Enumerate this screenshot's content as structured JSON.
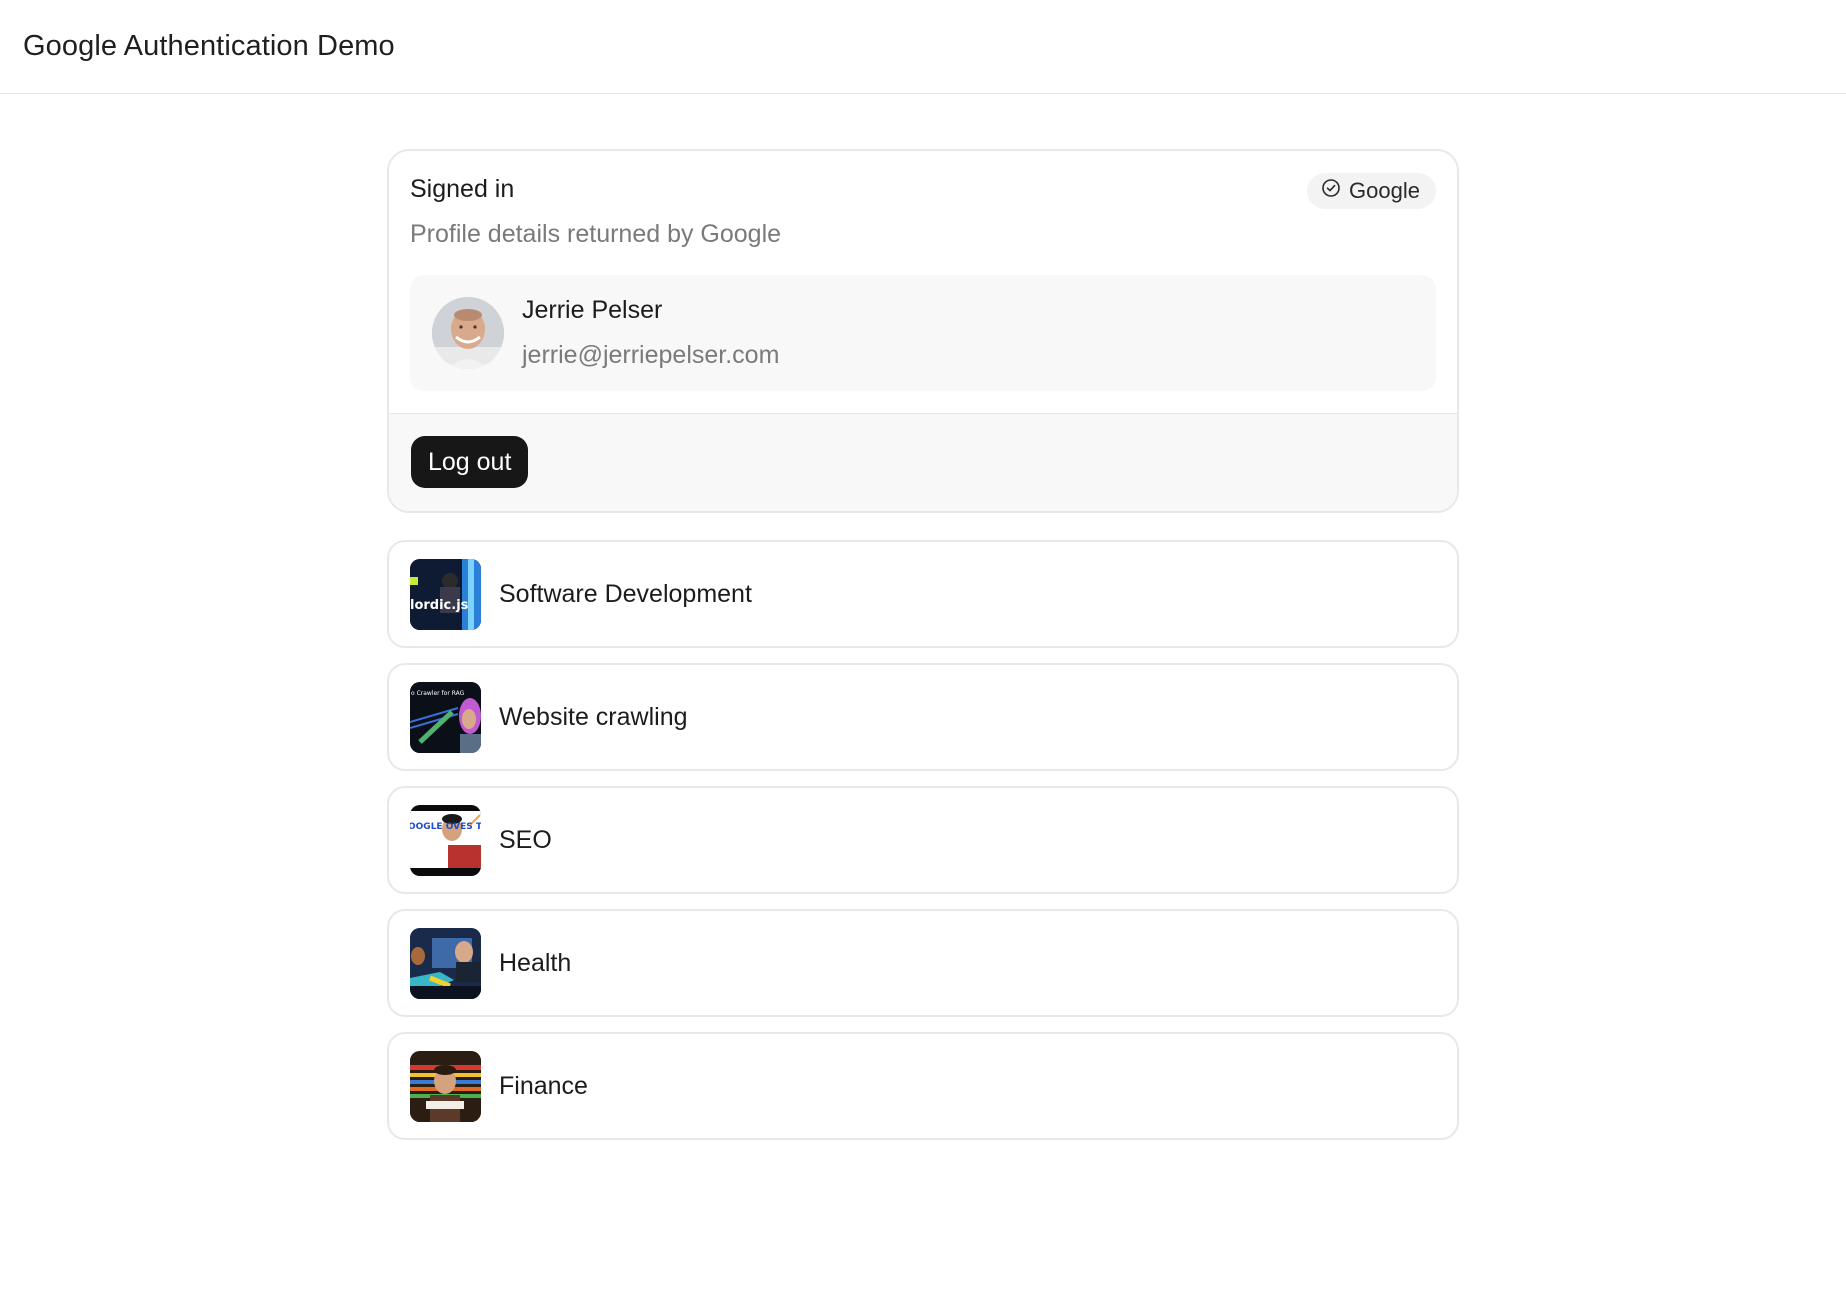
{
  "header": {
    "title": "Google Authentication Demo"
  },
  "auth": {
    "status": "Signed in",
    "subtitle": "Profile details returned by Google",
    "provider": {
      "label": "Google",
      "icon": "check-circle-icon"
    },
    "user": {
      "name": "Jerrie Pelser",
      "email": "jerrie@jerriepelser.com"
    },
    "logout_label": "Log out"
  },
  "topics": [
    {
      "label": "Software Development",
      "thumb_text": "lordic.js"
    },
    {
      "label": "Website crawling",
      "thumb_text": "o Crawler for RAG"
    },
    {
      "label": "SEO",
      "thumb_text": "OOGLE OVES THIS"
    },
    {
      "label": "Health"
    },
    {
      "label": "Finance"
    }
  ],
  "colors": {
    "accent": "#171717",
    "border": "#e8e8e8",
    "muted_text": "#7a7a7a",
    "panel_bg": "#f8f8f8"
  }
}
